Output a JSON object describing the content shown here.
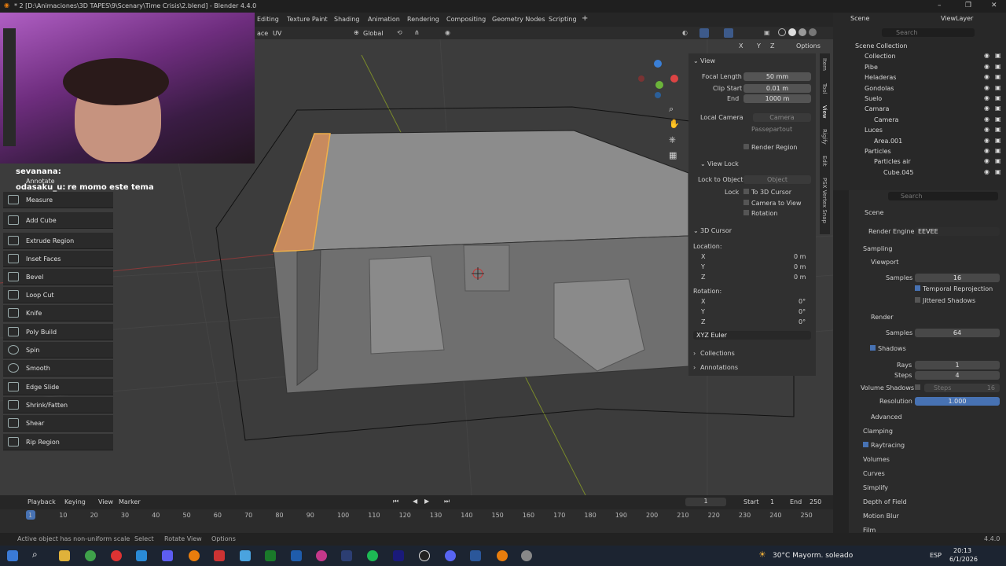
{
  "window": {
    "title": "* 2 [D:\\Animaciones\\3D TAPES\\9\\Scenary\\Time Crisis\\2.blend] - Blender 4.4.0",
    "minimize": "–",
    "maximize": "❐",
    "close": "✕"
  },
  "workspaces": [
    "Editing",
    "Texture Paint",
    "Shading",
    "Animation",
    "Rendering",
    "Compositing",
    "Geometry Nodes",
    "Scripting",
    "+"
  ],
  "header": {
    "mode_partial": "ace",
    "uv": "UV",
    "transform_orientation": "Global",
    "options": "Options",
    "axes": [
      "X",
      "Y",
      "Z"
    ]
  },
  "chat": {
    "user1": "sevanana:",
    "user2": "odasaku_u:",
    "msg2": "re momo este tema"
  },
  "tools": [
    "Annotate",
    "Measure",
    "Add Cube",
    "Extrude Region",
    "Inset Faces",
    "Bevel",
    "Loop Cut",
    "Knife",
    "Poly Build",
    "Spin",
    "Smooth",
    "Edge Slide",
    "Shrink/Fatten",
    "Shear",
    "Rip Region"
  ],
  "npanel": {
    "view": {
      "title": "View",
      "focal_length_label": "Focal Length",
      "focal_length": "50 mm",
      "clip_start_label": "Clip Start",
      "clip_start": "0.01 m",
      "end_label": "End",
      "end": "1000 m",
      "local_camera_label": "Local Camera",
      "camera": "Camera",
      "passepartout": "Passepartout",
      "render_region": "Render Region"
    },
    "view_lock": {
      "title": "View Lock",
      "lock_to_object_label": "Lock to Object",
      "object_placeholder": "Object",
      "lock_label": "Lock",
      "to_3d_cursor": "To 3D Cursor",
      "camera_to_view": "Camera to View",
      "rotation": "Rotation"
    },
    "cursor": {
      "title": "3D Cursor",
      "location_label": "Location:",
      "x": "X",
      "y": "Y",
      "z": "Z",
      "loc_x": "0 m",
      "loc_y": "0 m",
      "loc_z": "0 m",
      "rotation_label": "Rotation:",
      "rot_x": "0°",
      "rot_y": "0°",
      "rot_z": "0°",
      "euler": "XYZ Euler"
    },
    "collections": "Collections",
    "annotations": "Annotations",
    "tabs": [
      "Item",
      "Tool",
      "View",
      "Rigify",
      "Edit",
      "PSX Vertex Snap"
    ]
  },
  "outliner": {
    "scene": "Scene",
    "view_layer": "ViewLayer",
    "search_placeholder": "Search",
    "items": [
      {
        "label": "Scene Collection",
        "indent": 0
      },
      {
        "label": "Collection",
        "indent": 1
      },
      {
        "label": "Pibe",
        "indent": 1
      },
      {
        "label": "Heladeras",
        "indent": 1
      },
      {
        "label": "Gondolas",
        "indent": 1
      },
      {
        "label": "Suelo",
        "indent": 1
      },
      {
        "label": "Camara",
        "indent": 1
      },
      {
        "label": "Camera",
        "indent": 2
      },
      {
        "label": "Luces",
        "indent": 1
      },
      {
        "label": "Area.001",
        "indent": 2
      },
      {
        "label": "Particles",
        "indent": 1
      },
      {
        "label": "Particles air",
        "indent": 2
      },
      {
        "label": "Cube.045",
        "indent": 3
      }
    ]
  },
  "properties": {
    "search_placeholder": "Search",
    "scene": "Scene",
    "render_engine_label": "Render Engine",
    "render_engine": "EEVEE",
    "sampling": "Sampling",
    "viewport": "Viewport",
    "samples_label": "Samples",
    "viewport_samples": "16",
    "temporal_reprojection": "Temporal Reprojection",
    "jittered_shadows": "Jittered Shadows",
    "render": "Render",
    "render_samples": "64",
    "shadows": "Shadows",
    "rays_label": "Rays",
    "rays": "1",
    "steps_label": "Steps",
    "steps": "4",
    "volume_shadows": "Volume Shadows",
    "vol_steps_label": "Steps",
    "vol_steps": "16",
    "resolution_label": "Resolution",
    "resolution": "1.000",
    "advanced": "Advanced",
    "clamping": "Clamping",
    "raytracing": "Raytracing",
    "volumes": "Volumes",
    "curves": "Curves",
    "simplify": "Simplify",
    "depth_of_field": "Depth of Field",
    "motion_blur": "Motion Blur",
    "film": "Film"
  },
  "timeline": {
    "playback": "Playback",
    "keying": "Keying",
    "view": "View",
    "marker": "Marker",
    "current_frame": "1",
    "start_label": "Start",
    "start": "1",
    "end_label": "End",
    "end": "250",
    "frames": [
      "1",
      "10",
      "20",
      "30",
      "40",
      "50",
      "60",
      "70",
      "80",
      "90",
      "100",
      "110",
      "120",
      "130",
      "140",
      "150",
      "160",
      "170",
      "180",
      "190",
      "200",
      "210",
      "220",
      "230",
      "240",
      "250"
    ]
  },
  "status": {
    "message": "Active object has non-uniform scale",
    "select": "Select",
    "rotate_view": "Rotate View",
    "options": "Options",
    "version": "4.4.0"
  },
  "taskbar": {
    "weather": "30°C  Mayorm. soleado",
    "lang": "ESP",
    "time": "20:13",
    "date": "6/1/2026"
  }
}
